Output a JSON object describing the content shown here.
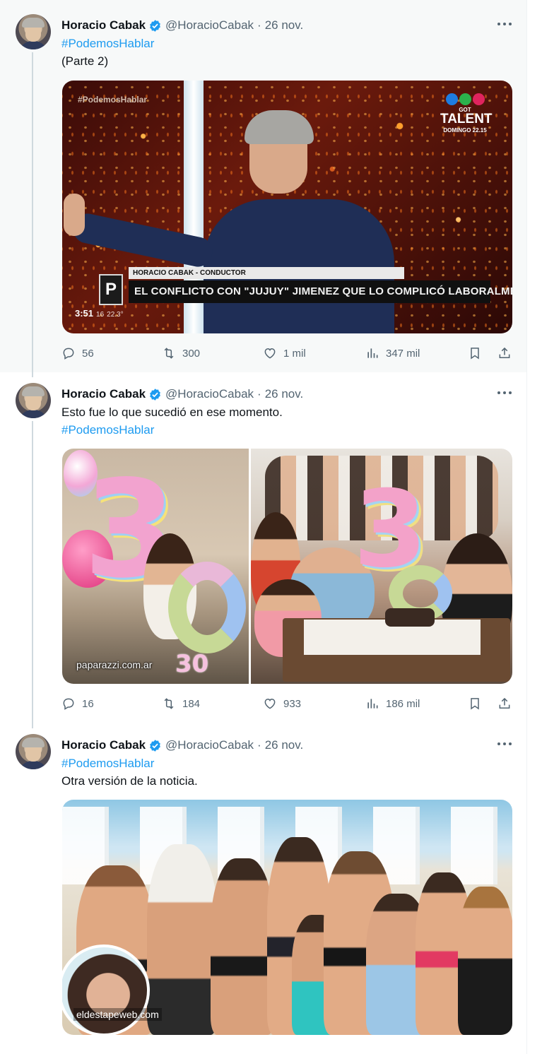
{
  "author": {
    "name": "Horacio Cabak",
    "handle": "@HoracioCabak",
    "verified": true
  },
  "colors": {
    "link": "#1d9bf0",
    "secondary": "#536471",
    "verified_badge": "#1d9bf0"
  },
  "tweets": [
    {
      "date": "26 nov.",
      "lines": [
        "#PodemosHablar",
        "(Parte 2)"
      ],
      "media": {
        "type": "video",
        "overlay_hashtag": "#PodemosHablar",
        "channel_logo_sub": "GOT",
        "channel_logo_main": "TALENT",
        "channel_logo_caption": "DOMINGO 22.15",
        "lower_third_badge": "P",
        "lower_third_name": "HORACIO CABAK - CONDUCTOR",
        "lower_third_headline": "EL CONFLICTO CON \"JUJUY\" JIMENEZ QUE LO COMPLICÓ LABORALMENTE",
        "time": "3:51",
        "time_extra": "16",
        "clock": "22.3°"
      },
      "actions": {
        "replies": "56",
        "retweets": "300",
        "likes": "1 mil",
        "views": "347 mil"
      }
    },
    {
      "date": "26 nov.",
      "lines": [
        "Esto fue lo que sucedió en ese momento.",
        "#PodemosHablar"
      ],
      "media": {
        "type": "gallery",
        "watermark": "paparazzi.com.ar",
        "balloon_left": "3",
        "balloon_right": "3",
        "cake_number": "30"
      },
      "actions": {
        "replies": "16",
        "retweets": "184",
        "likes": "933",
        "views": "186 mil"
      }
    },
    {
      "date": "26 nov.",
      "lines": [
        "#PodemosHablar",
        "Otra versión de la noticia."
      ],
      "media": {
        "type": "photo",
        "watermark": "eldestapeweb.com"
      }
    }
  ],
  "icons": {
    "reply": "reply-icon",
    "retweet": "retweet-icon",
    "like": "heart-icon",
    "views": "views-icon",
    "bookmark": "bookmark-icon",
    "share": "share-icon",
    "more": "more-icon"
  }
}
